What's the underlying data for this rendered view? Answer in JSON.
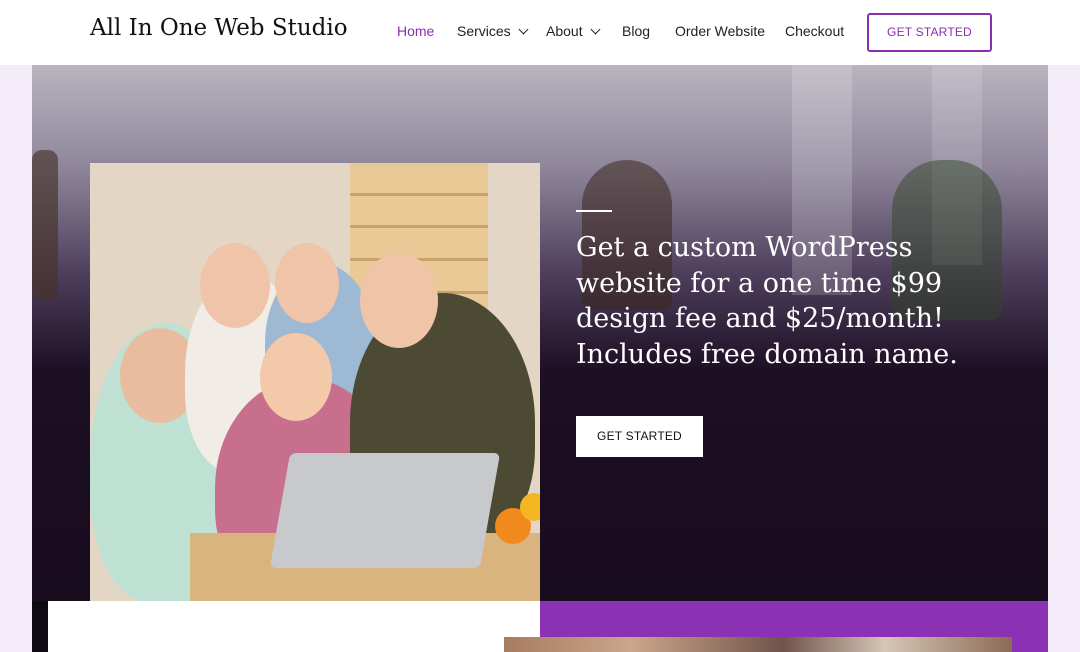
{
  "header": {
    "logo": "All In One Web Studio",
    "nav": [
      {
        "label": "Home",
        "active": true,
        "has_dropdown": false
      },
      {
        "label": "Services",
        "active": false,
        "has_dropdown": true
      },
      {
        "label": "About",
        "active": false,
        "has_dropdown": true
      },
      {
        "label": "Blog",
        "active": false,
        "has_dropdown": false
      },
      {
        "label": "Order Website",
        "active": false,
        "has_dropdown": false
      },
      {
        "label": "Checkout",
        "active": false,
        "has_dropdown": false
      }
    ],
    "cta_label": "GET STARTED"
  },
  "hero": {
    "headline": "Get a custom WordPress website for a one time $99 design fee and $25/month! Includes free domain name.",
    "cta_label": "GET STARTED"
  },
  "colors": {
    "accent": "#8a2fae",
    "hero_dark": "#170b1d",
    "band_purple": "#8a31b4"
  }
}
